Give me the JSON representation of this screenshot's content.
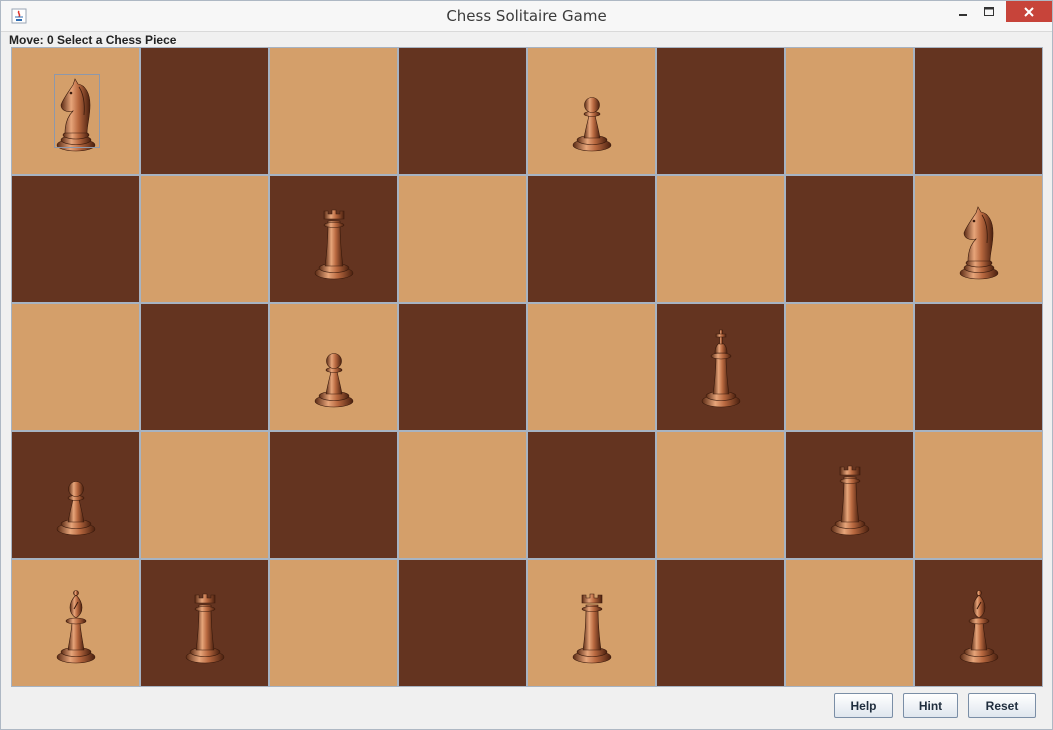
{
  "window": {
    "title": "Chess Solitaire Game",
    "icon": "java-cup-icon",
    "controls": [
      "minimize-icon",
      "maximize-icon",
      "close-icon"
    ]
  },
  "status": {
    "text": "Move: 0 Select a Chess Piece"
  },
  "board": {
    "rows": 5,
    "cols": 8,
    "light_color": "#d49f6a",
    "dark_color": "#643420",
    "selected_square": "r0c0",
    "squares": [
      [
        {
          "shade": "light",
          "piece": "knight"
        },
        {
          "shade": "dark",
          "piece": ""
        },
        {
          "shade": "light",
          "piece": ""
        },
        {
          "shade": "dark",
          "piece": ""
        },
        {
          "shade": "light",
          "piece": "pawn"
        },
        {
          "shade": "dark",
          "piece": ""
        },
        {
          "shade": "light",
          "piece": ""
        },
        {
          "shade": "dark",
          "piece": ""
        }
      ],
      [
        {
          "shade": "dark",
          "piece": ""
        },
        {
          "shade": "light",
          "piece": ""
        },
        {
          "shade": "dark",
          "piece": "rook"
        },
        {
          "shade": "light",
          "piece": ""
        },
        {
          "shade": "dark",
          "piece": ""
        },
        {
          "shade": "light",
          "piece": ""
        },
        {
          "shade": "dark",
          "piece": ""
        },
        {
          "shade": "light",
          "piece": "knight"
        }
      ],
      [
        {
          "shade": "light",
          "piece": ""
        },
        {
          "shade": "dark",
          "piece": ""
        },
        {
          "shade": "light",
          "piece": "pawn"
        },
        {
          "shade": "dark",
          "piece": ""
        },
        {
          "shade": "light",
          "piece": ""
        },
        {
          "shade": "dark",
          "piece": "king"
        },
        {
          "shade": "light",
          "piece": ""
        },
        {
          "shade": "dark",
          "piece": ""
        }
      ],
      [
        {
          "shade": "dark",
          "piece": "pawn"
        },
        {
          "shade": "light",
          "piece": ""
        },
        {
          "shade": "dark",
          "piece": ""
        },
        {
          "shade": "light",
          "piece": ""
        },
        {
          "shade": "dark",
          "piece": ""
        },
        {
          "shade": "light",
          "piece": ""
        },
        {
          "shade": "dark",
          "piece": "rook"
        },
        {
          "shade": "light",
          "piece": ""
        }
      ],
      [
        {
          "shade": "light",
          "piece": "bishop"
        },
        {
          "shade": "dark",
          "piece": "rook"
        },
        {
          "shade": "light",
          "piece": ""
        },
        {
          "shade": "dark",
          "piece": ""
        },
        {
          "shade": "light",
          "piece": "rook"
        },
        {
          "shade": "dark",
          "piece": ""
        },
        {
          "shade": "light",
          "piece": ""
        },
        {
          "shade": "dark",
          "piece": "bishop"
        }
      ]
    ]
  },
  "buttons": {
    "help": "Help",
    "hint": "Hint",
    "reset": "Reset"
  }
}
